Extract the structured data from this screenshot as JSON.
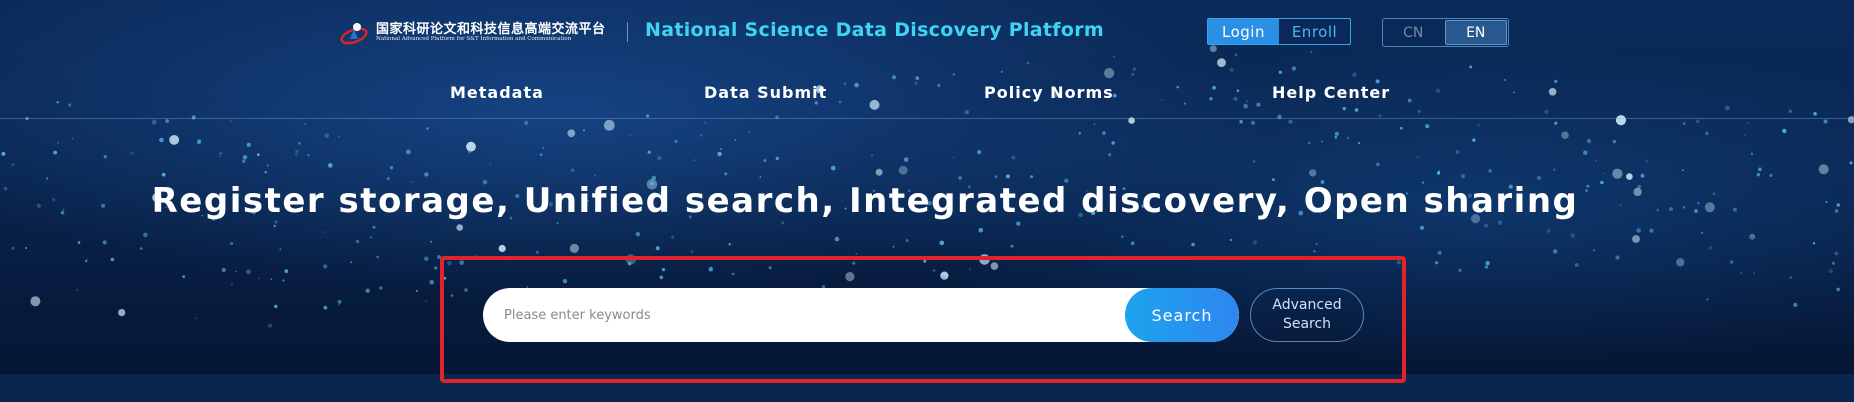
{
  "header": {
    "logo_cn": "国家科研论文和科技信息高端交流平台",
    "logo_en": "National Advanced Platform for S&T Information and Communication",
    "logo_icon": "nsti-logo-icon",
    "platform_title": "National Science Data Discovery Platform",
    "auth": {
      "login_label": "Login",
      "enroll_label": "Enroll",
      "active": "Login"
    },
    "language": {
      "cn_label": "CN",
      "en_label": "EN",
      "active": "EN"
    }
  },
  "nav": {
    "items": [
      {
        "label": "Metadata"
      },
      {
        "label": "Data Submit"
      },
      {
        "label": "Policy Norms"
      },
      {
        "label": "Help Center"
      }
    ]
  },
  "hero": {
    "slogan": "Register storage, Unified search, Integrated discovery, Open sharing"
  },
  "search": {
    "placeholder": "Please enter keywords",
    "value": "",
    "button_label": "Search",
    "advanced_line1": "Advanced",
    "advanced_line2": "Search"
  },
  "colors": {
    "accent": "#3ed4f2",
    "button": "#2a90e4",
    "highlight_border": "#e3232b",
    "background": "#0a2650"
  }
}
